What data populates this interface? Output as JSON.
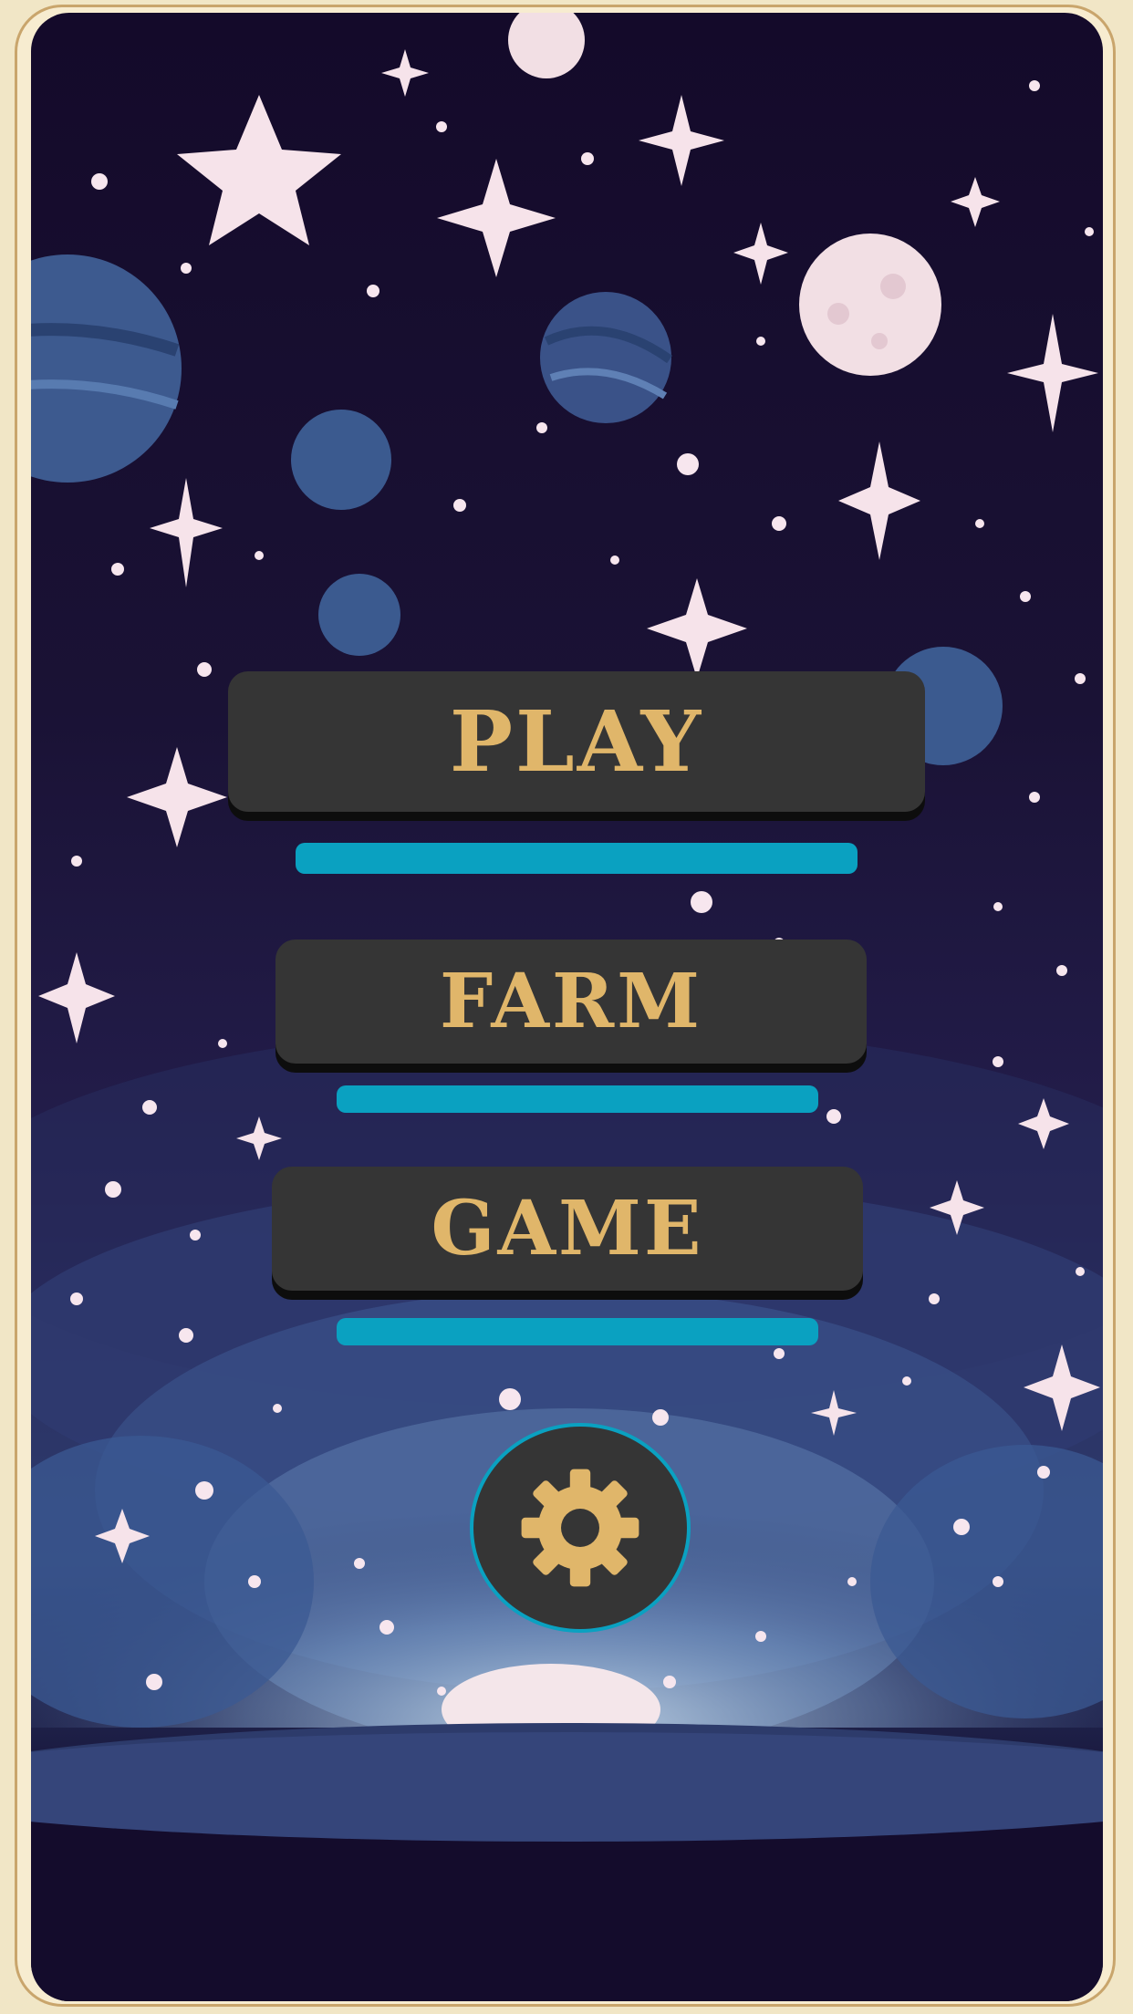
{
  "menu": {
    "play_label": "PLAY",
    "farm_label": "FARM",
    "game_label": "GAME"
  },
  "icons": {
    "settings": "gear-icon"
  },
  "colors": {
    "button_bg": "#353535",
    "button_text": "#e0b66a",
    "accent_bar": "#0aa1c1",
    "sky": "#140a2a",
    "frame": "#f7ecd0"
  }
}
